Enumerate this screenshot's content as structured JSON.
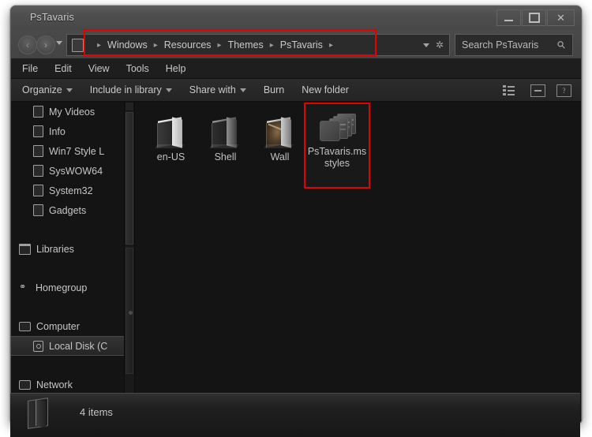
{
  "window": {
    "title": "PsTavaris",
    "controls": {
      "minimize": "Minimize",
      "maximize": "Maximize",
      "close": "Close"
    }
  },
  "navigation": {
    "back_label": "‹",
    "forward_label": "›",
    "recent_pages_label": "Recent pages",
    "address_icon": "computer-icon",
    "breadcrumbs": [
      "Windows",
      "Resources",
      "Themes",
      "PsTavaris"
    ],
    "separator": "▸",
    "previous_locations_label": "Previous locations",
    "refresh_label": "✲"
  },
  "search": {
    "placeholder": "Search PsTavaris",
    "icon": "magnifier-icon"
  },
  "menubar": {
    "items": [
      "File",
      "Edit",
      "View",
      "Tools",
      "Help"
    ]
  },
  "toolbar": {
    "items": [
      {
        "label": "Organize",
        "has_dropdown": true
      },
      {
        "label": "Include in library",
        "has_dropdown": true
      },
      {
        "label": "Share with",
        "has_dropdown": true
      },
      {
        "label": "Burn",
        "has_dropdown": false
      },
      {
        "label": "New folder",
        "has_dropdown": false
      }
    ],
    "view_button": "change-view-icon",
    "preview_button": "preview-pane-icon",
    "help_button": "help-icon"
  },
  "sidebar": {
    "items": [
      {
        "label": "My Videos",
        "icon": "folder-icon",
        "level": "child",
        "selected": false
      },
      {
        "label": "Info",
        "icon": "folder-icon",
        "level": "child",
        "selected": false
      },
      {
        "label": "Win7 Style L",
        "icon": "folder-icon",
        "level": "child",
        "selected": false
      },
      {
        "label": "SysWOW64",
        "icon": "folder-icon",
        "level": "child",
        "selected": false
      },
      {
        "label": "System32",
        "icon": "folder-icon",
        "level": "child",
        "selected": false
      },
      {
        "label": "Gadgets",
        "icon": "folder-icon",
        "level": "child",
        "selected": false
      },
      {
        "label": "Libraries",
        "icon": "library-icon",
        "level": "root",
        "selected": false
      },
      {
        "label": "Homegroup",
        "icon": "homegroup-icon",
        "level": "root",
        "selected": false
      },
      {
        "label": "Computer",
        "icon": "computer-icon",
        "level": "root",
        "selected": false
      },
      {
        "label": "Local Disk (C",
        "icon": "disk-icon",
        "level": "child",
        "selected": true
      },
      {
        "label": "Network",
        "icon": "network-icon",
        "level": "root",
        "selected": false
      }
    ]
  },
  "files": {
    "items": [
      {
        "name": "en-US",
        "type": "folder",
        "selected": false
      },
      {
        "name": "Shell",
        "type": "folder",
        "selected": false
      },
      {
        "name": "Wall",
        "type": "folder-picture",
        "selected": false
      },
      {
        "name": "PsTavaris.msstyles",
        "type": "msstyles-file",
        "selected": true
      }
    ]
  },
  "statusbar": {
    "icon": "folder-icon",
    "text": "4 items"
  },
  "annotations": {
    "highlight_color": "#e60000",
    "boxes": [
      "address-bar-highlight",
      "selected-file-highlight"
    ]
  },
  "colors": {
    "titlebar": "#4e4e4e",
    "content_background": "#141414",
    "text": "#c6c6c6",
    "accent_red": "#e60000"
  }
}
